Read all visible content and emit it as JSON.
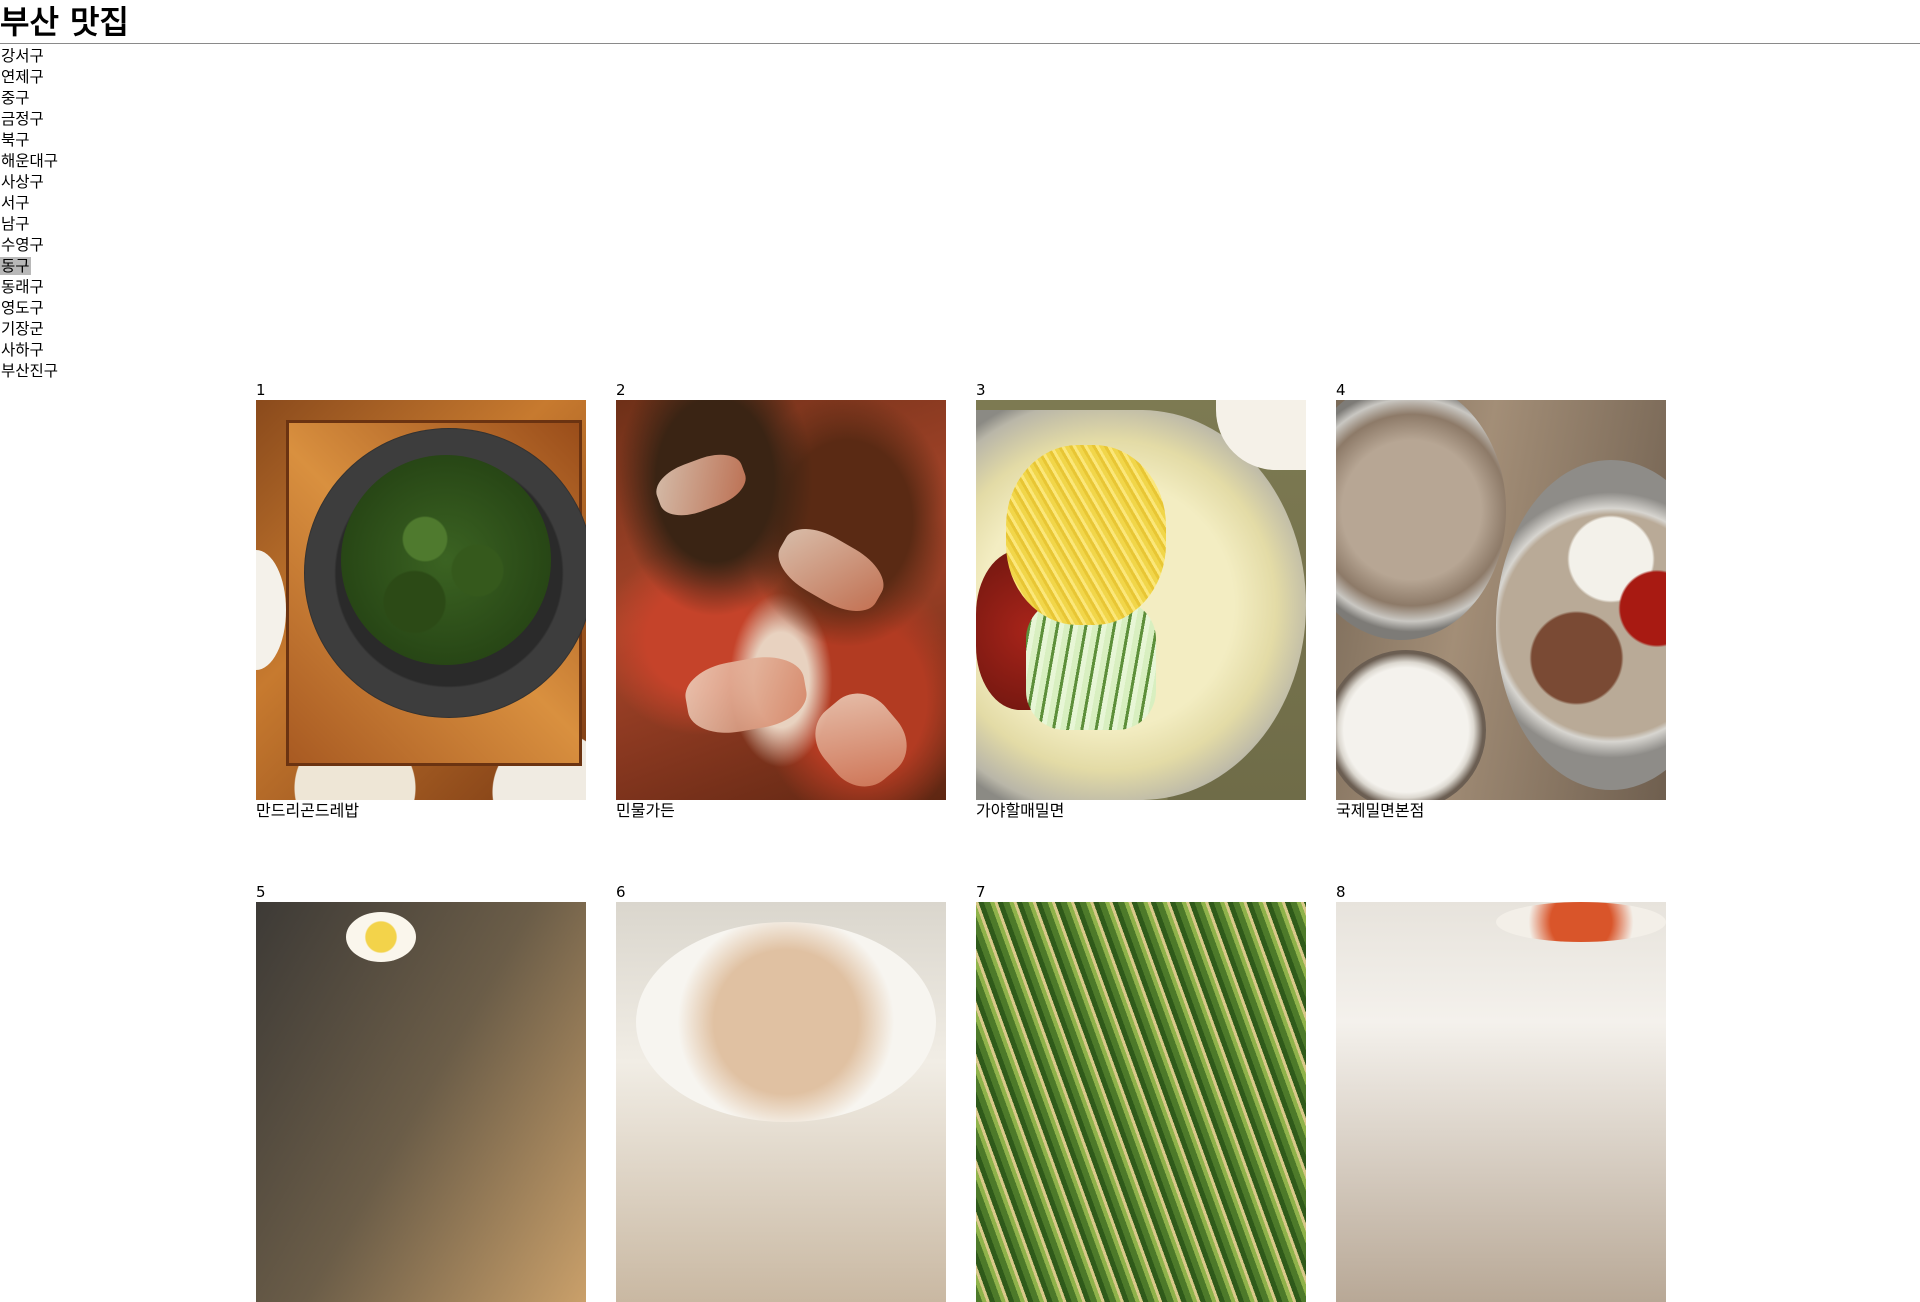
{
  "page": {
    "title": "부산 맛집"
  },
  "districts": {
    "selected": "동구",
    "items": [
      "강서구",
      "연제구",
      "중구",
      "금정구",
      "북구",
      "해운대구",
      "사상구",
      "서구",
      "남구",
      "수영구",
      "동구",
      "동래구",
      "영도구",
      "기장군",
      "사하구",
      "부산진구"
    ]
  },
  "restaurants": [
    {
      "rank": "1",
      "name": "만드리곤드레밥"
    },
    {
      "rank": "2",
      "name": "민물가든"
    },
    {
      "rank": "3",
      "name": "가야할매밀면"
    },
    {
      "rank": "4",
      "name": "국제밀면본점"
    },
    {
      "rank": "5",
      "name": ""
    },
    {
      "rank": "6",
      "name": ""
    },
    {
      "rank": "7",
      "name": ""
    },
    {
      "rank": "8",
      "name": ""
    }
  ],
  "colors": {
    "selected_highlight": "#b8b8b8",
    "rule": "#8a8a8a"
  }
}
